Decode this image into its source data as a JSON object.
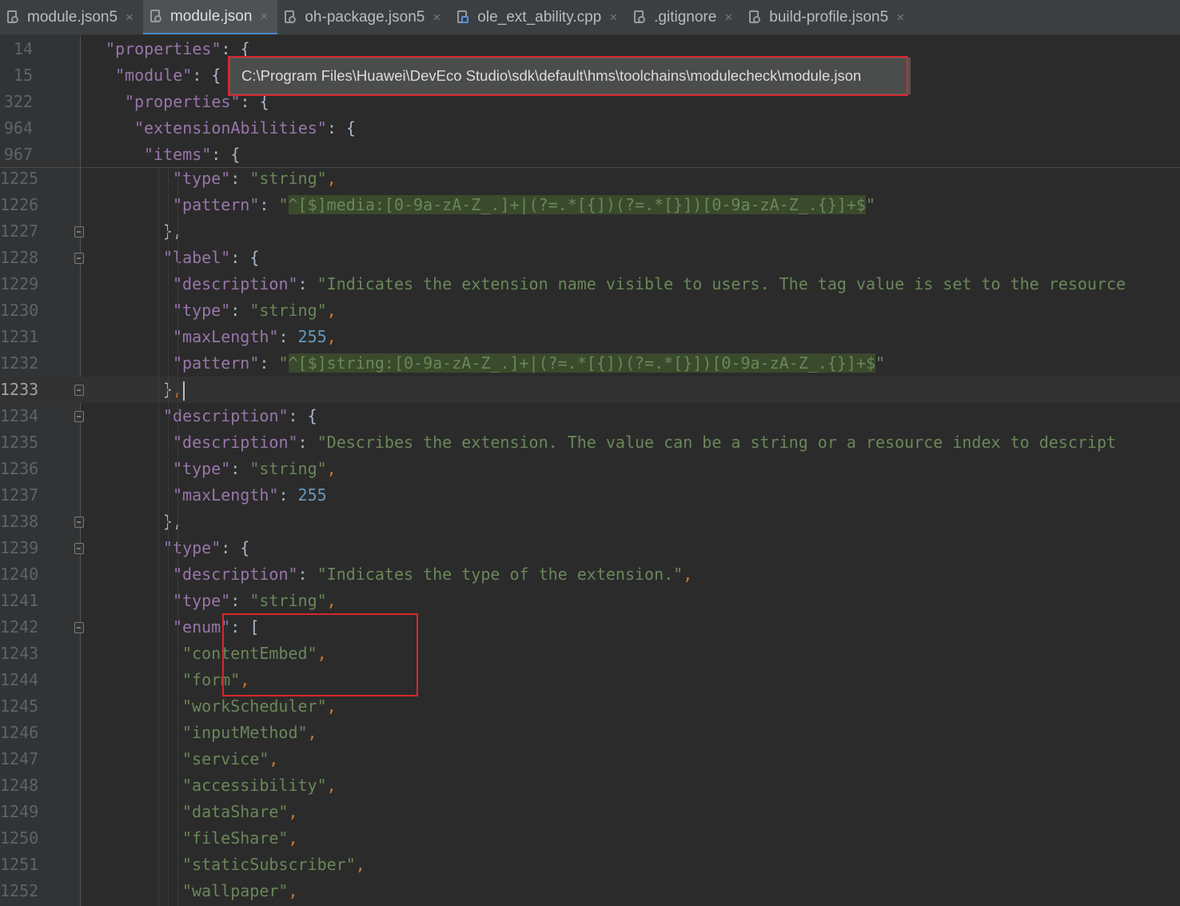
{
  "tabs": [
    {
      "label": "module.json5",
      "icon": "json-file-icon",
      "active": false,
      "closable": true
    },
    {
      "label": "module.json",
      "icon": "json-file-icon",
      "active": true,
      "closable": true
    },
    {
      "label": "oh-package.json5",
      "icon": "json-file-icon",
      "active": false,
      "closable": true
    },
    {
      "label": "ole_ext_ability.cpp",
      "icon": "cpp-file-icon",
      "active": false,
      "closable": true
    },
    {
      "label": ".gitignore",
      "icon": "gitignore-file-icon",
      "active": false,
      "closable": true
    },
    {
      "label": "build-profile.json5",
      "icon": "json-file-icon",
      "active": false,
      "closable": true
    }
  ],
  "tab_close_glyph": "×",
  "tooltip": {
    "text": "C:\\Program Files\\Huawei\\DevEco Studio\\sdk\\default\\hms\\toolchains\\modulecheck\\module.json"
  },
  "sticky_lines": [
    {
      "number": "14",
      "indent": 5,
      "tokens": [
        [
          "k",
          "\"properties\""
        ],
        [
          "t",
          ": {"
        ]
      ]
    },
    {
      "number": "15",
      "indent": 6,
      "tokens": [
        [
          "k",
          "\"module\""
        ],
        [
          "t",
          ": {"
        ]
      ]
    },
    {
      "number": "322",
      "indent": 7,
      "tokens": [
        [
          "k",
          "\"properties\""
        ],
        [
          "t",
          ": {"
        ]
      ]
    },
    {
      "number": "964",
      "indent": 8,
      "tokens": [
        [
          "k",
          "\"extensionAbilities\""
        ],
        [
          "t",
          ": {"
        ]
      ]
    },
    {
      "number": "967",
      "indent": 9,
      "tokens": [
        [
          "k",
          "\"items\""
        ],
        [
          "t",
          ": {"
        ]
      ]
    }
  ],
  "lines": [
    {
      "number": "1225",
      "indent": 12,
      "tokens": [
        [
          "k",
          "\"type\""
        ],
        [
          "t",
          ": "
        ],
        [
          "s",
          "\"string\""
        ],
        [
          "p",
          ","
        ]
      ]
    },
    {
      "number": "1226",
      "indent": 12,
      "tokens": [
        [
          "k",
          "\"pattern\""
        ],
        [
          "t",
          ": "
        ],
        [
          "s",
          "\""
        ],
        [
          "rx",
          "^[$]media:[0-9a-zA-Z_.]+|(?=.*[{])(?=.*[}])[0-9a-zA-Z_.{}]+$"
        ],
        [
          "s",
          "\""
        ]
      ]
    },
    {
      "number": "1227",
      "indent": 11,
      "fold": true,
      "tokens": [
        [
          "t",
          "},"
        ]
      ]
    },
    {
      "number": "1228",
      "indent": 11,
      "fold": true,
      "tokens": [
        [
          "k",
          "\"label\""
        ],
        [
          "t",
          ": {"
        ]
      ]
    },
    {
      "number": "1229",
      "indent": 12,
      "tokens": [
        [
          "k",
          "\"description\""
        ],
        [
          "t",
          ": "
        ],
        [
          "s",
          "\"Indicates the extension name visible to users. The tag value is set to the resource"
        ]
      ]
    },
    {
      "number": "1230",
      "indent": 12,
      "tokens": [
        [
          "k",
          "\"type\""
        ],
        [
          "t",
          ": "
        ],
        [
          "s",
          "\"string\""
        ],
        [
          "p",
          ","
        ]
      ]
    },
    {
      "number": "1231",
      "indent": 12,
      "tokens": [
        [
          "k",
          "\"maxLength\""
        ],
        [
          "t",
          ": "
        ],
        [
          "n",
          "255"
        ],
        [
          "p",
          ","
        ]
      ]
    },
    {
      "number": "1232",
      "indent": 12,
      "tokens": [
        [
          "k",
          "\"pattern\""
        ],
        [
          "t",
          ": "
        ],
        [
          "s",
          "\""
        ],
        [
          "rx",
          "^[$]string:[0-9a-zA-Z_.]+|(?=.*[{])(?=.*[}])[0-9a-zA-Z_.{}]+$"
        ],
        [
          "s",
          "\""
        ]
      ]
    },
    {
      "number": "1233",
      "indent": 11,
      "fold": true,
      "current": true,
      "tokens": [
        [
          "t",
          "}"
        ],
        [
          "p",
          ","
        ]
      ]
    },
    {
      "number": "1234",
      "indent": 11,
      "fold": true,
      "tokens": [
        [
          "k",
          "\"description\""
        ],
        [
          "t",
          ": {"
        ]
      ]
    },
    {
      "number": "1235",
      "indent": 12,
      "tokens": [
        [
          "k",
          "\"description\""
        ],
        [
          "t",
          ": "
        ],
        [
          "s",
          "\"Describes the extension. The value can be a string or a resource index to descript"
        ]
      ]
    },
    {
      "number": "1236",
      "indent": 12,
      "tokens": [
        [
          "k",
          "\"type\""
        ],
        [
          "t",
          ": "
        ],
        [
          "s",
          "\"string\""
        ],
        [
          "p",
          ","
        ]
      ]
    },
    {
      "number": "1237",
      "indent": 12,
      "tokens": [
        [
          "k",
          "\"maxLength\""
        ],
        [
          "t",
          ": "
        ],
        [
          "n",
          "255"
        ]
      ]
    },
    {
      "number": "1238",
      "indent": 11,
      "fold": true,
      "tokens": [
        [
          "t",
          "},"
        ]
      ]
    },
    {
      "number": "1239",
      "indent": 11,
      "fold": true,
      "tokens": [
        [
          "k",
          "\"type\""
        ],
        [
          "t",
          ": {"
        ]
      ]
    },
    {
      "number": "1240",
      "indent": 12,
      "tokens": [
        [
          "k",
          "\"description\""
        ],
        [
          "t",
          ": "
        ],
        [
          "s",
          "\"Indicates the type of the extension.\""
        ],
        [
          "p",
          ","
        ]
      ]
    },
    {
      "number": "1241",
      "indent": 12,
      "tokens": [
        [
          "k",
          "\"type\""
        ],
        [
          "t",
          ": "
        ],
        [
          "s",
          "\"string\""
        ],
        [
          "p",
          ","
        ]
      ]
    },
    {
      "number": "1242",
      "indent": 12,
      "fold": true,
      "tokens": [
        [
          "k",
          "\"enum\""
        ],
        [
          "t",
          ": ["
        ]
      ]
    },
    {
      "number": "1243",
      "indent": 13,
      "tokens": [
        [
          "s",
          "\"contentEmbed\""
        ],
        [
          "p",
          ","
        ]
      ]
    },
    {
      "number": "1244",
      "indent": 13,
      "tokens": [
        [
          "s",
          "\"form\""
        ],
        [
          "p",
          ","
        ]
      ]
    },
    {
      "number": "1245",
      "indent": 13,
      "tokens": [
        [
          "s",
          "\"workScheduler\""
        ],
        [
          "p",
          ","
        ]
      ]
    },
    {
      "number": "1246",
      "indent": 13,
      "tokens": [
        [
          "s",
          "\"inputMethod\""
        ],
        [
          "p",
          ","
        ]
      ]
    },
    {
      "number": "1247",
      "indent": 13,
      "tokens": [
        [
          "s",
          "\"service\""
        ],
        [
          "p",
          ","
        ]
      ]
    },
    {
      "number": "1248",
      "indent": 13,
      "tokens": [
        [
          "s",
          "\"accessibility\""
        ],
        [
          "p",
          ","
        ]
      ]
    },
    {
      "number": "1249",
      "indent": 13,
      "tokens": [
        [
          "s",
          "\"dataShare\""
        ],
        [
          "p",
          ","
        ]
      ]
    },
    {
      "number": "1250",
      "indent": 13,
      "tokens": [
        [
          "s",
          "\"fileShare\""
        ],
        [
          "p",
          ","
        ]
      ]
    },
    {
      "number": "1251",
      "indent": 13,
      "tokens": [
        [
          "s",
          "\"staticSubscriber\""
        ],
        [
          "p",
          ","
        ]
      ]
    },
    {
      "number": "1252",
      "indent": 13,
      "tokens": [
        [
          "s",
          "\"wallpaper\""
        ],
        [
          "p",
          ","
        ]
      ]
    }
  ],
  "colors": {
    "key": "#9876aa",
    "string": "#6a8759",
    "number": "#6897bb",
    "punct": "#cc7832",
    "annotation": "#d9262c"
  }
}
